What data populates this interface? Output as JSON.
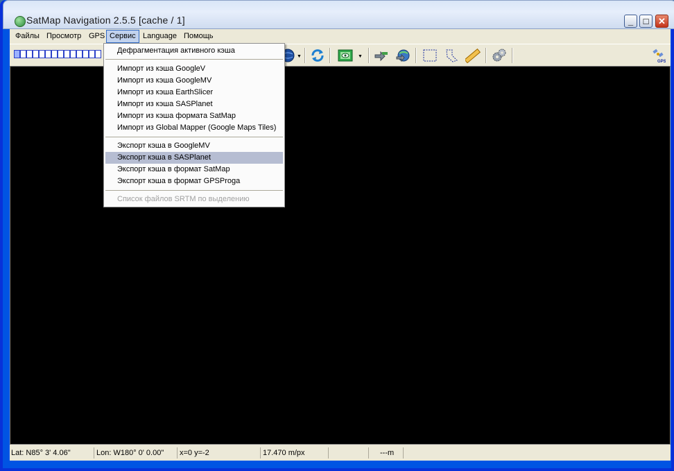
{
  "window": {
    "title": "SatMap Navigation 2.5.5  [cache / 1]",
    "buttons": {
      "minimize": "_",
      "maximize": "□",
      "close": "✕"
    }
  },
  "menubar": {
    "items": [
      "Файлы",
      "Просмотр",
      "GPS",
      "Сервис",
      "Language",
      "Помощь"
    ],
    "active": "Сервис"
  },
  "toolbar": {
    "zoom_level": 1,
    "zoom_steps": 14,
    "icons": [
      "globe-icon",
      "refresh-icon",
      "layer-view-icon",
      "route-arrows-icon",
      "globe-route-icon",
      "select-rect-icon",
      "select-poly-icon",
      "ruler-icon",
      "settings-gears-icon",
      "gps-satellite-icon"
    ]
  },
  "dropdown": {
    "items": [
      {
        "label": "Дефрагментация активного кэша",
        "state": "normal"
      },
      {
        "label": "Импорт из кэша GoogleV",
        "state": "normal"
      },
      {
        "label": "Импорт из кэша GoogleMV",
        "state": "normal"
      },
      {
        "label": "Импорт из кэша EarthSlicer",
        "state": "normal"
      },
      {
        "label": "Импорт из кэша SASPlanet",
        "state": "normal"
      },
      {
        "label": "Импорт из кэша формата SatMap",
        "state": "normal"
      },
      {
        "label": "Импорт из Global Mapper (Google Maps Tiles)",
        "state": "normal"
      },
      {
        "label": "Экспорт кэша в GoogleMV",
        "state": "normal"
      },
      {
        "label": "Экспорт кэша в SASPlanet",
        "state": "highlighted"
      },
      {
        "label": "Экспорт кэша в формат SatMap",
        "state": "normal"
      },
      {
        "label": "Экспорт кэша в формат GPSProga",
        "state": "normal"
      },
      {
        "label": "Список файлов SRTM по выделению",
        "state": "disabled"
      }
    ]
  },
  "statusbar": {
    "lat": "Lat: N85° 3' 4.06\"",
    "lon": "Lon: W180° 0' 0.00\"",
    "xy": "x=0 y=-2",
    "scale": "17.470 m/px",
    "empty": "",
    "distance": "---m"
  },
  "colors": {
    "map_background": "#000000",
    "menu_highlight": "#b6bdd2",
    "title_bar": "#dfe8f6"
  }
}
